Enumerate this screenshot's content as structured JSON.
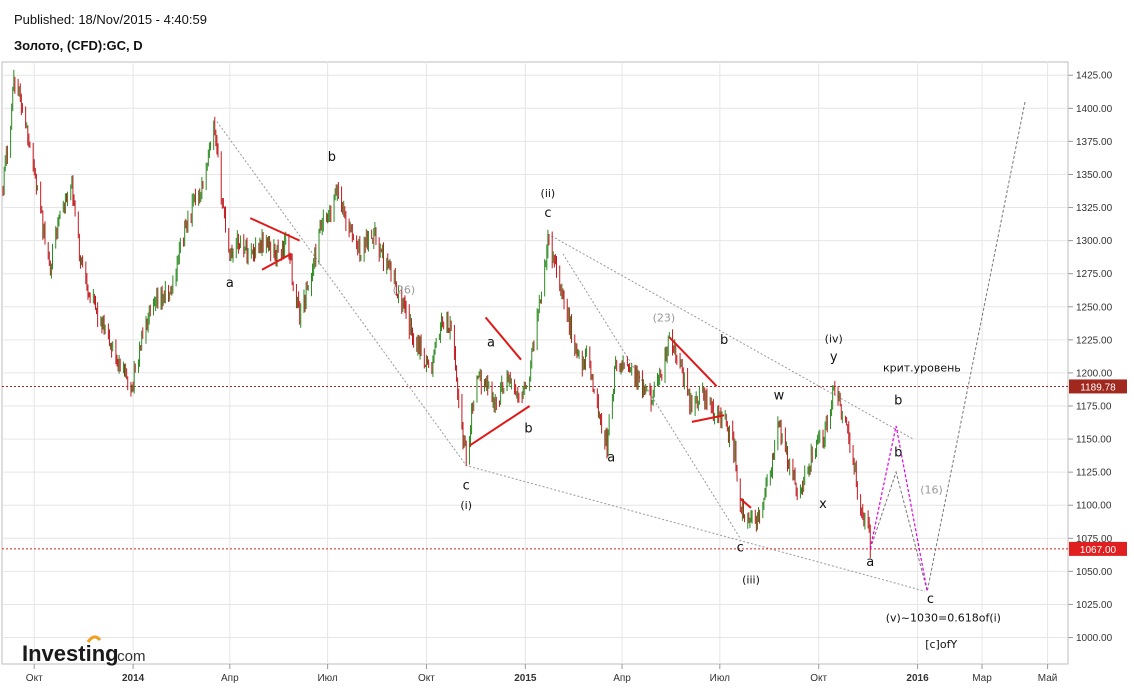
{
  "header": {
    "published": "Published: 18/Nov/2015 - 4:40:59",
    "title": "Золото, (CFD):GC, D"
  },
  "logo": {
    "brand": "Investing",
    "suffix": ".com"
  },
  "colors": {
    "up": "#2a8a1f",
    "down": "#c0181c",
    "wedge": "#e01818",
    "level": "#a0281e",
    "magenta": "#e000e0",
    "guide": "#999999"
  },
  "chart_data": {
    "type": "line",
    "title": "Золото, (CFD):GC, D",
    "xlabel": "",
    "ylabel": "",
    "ylim": [
      980,
      1435
    ],
    "xlim": [
      "2013-09-01",
      "2016-05-20"
    ],
    "grid": true,
    "y_ticks": [
      "1000.00",
      "1025.00",
      "1050.00",
      "1075.00",
      "1100.00",
      "1125.00",
      "1150.00",
      "1175.00",
      "1200.00",
      "1225.00",
      "1250.00",
      "1275.00",
      "1300.00",
      "1325.00",
      "1350.00",
      "1375.00",
      "1400.00",
      "1425.00"
    ],
    "x_ticks": [
      {
        "label": "Окт",
        "date": "2013-10-01"
      },
      {
        "label": "2014",
        "date": "2014-01-01"
      },
      {
        "label": "Апр",
        "date": "2014-04-01"
      },
      {
        "label": "Июл",
        "date": "2014-07-01"
      },
      {
        "label": "Окт",
        "date": "2014-10-01"
      },
      {
        "label": "2015",
        "date": "2015-01-01"
      },
      {
        "label": "Апр",
        "date": "2015-04-01"
      },
      {
        "label": "Июл",
        "date": "2015-07-01"
      },
      {
        "label": "Окт",
        "date": "2015-10-01"
      },
      {
        "label": "2016",
        "date": "2016-01-01"
      },
      {
        "label": "Мар",
        "date": "2016-03-01"
      },
      {
        "label": "Май",
        "date": "2016-05-01"
      }
    ],
    "price_path": [
      [
        "2013-09-01",
        1340
      ],
      [
        "2013-09-08",
        1380
      ],
      [
        "2013-09-12",
        1425
      ],
      [
        "2013-09-20",
        1400
      ],
      [
        "2013-09-28",
        1370
      ],
      [
        "2013-10-05",
        1330
      ],
      [
        "2013-10-15",
        1280
      ],
      [
        "2013-10-25",
        1320
      ],
      [
        "2013-11-05",
        1340
      ],
      [
        "2013-11-12",
        1290
      ],
      [
        "2013-11-22",
        1260
      ],
      [
        "2013-12-05",
        1230
      ],
      [
        "2013-12-15",
        1215
      ],
      [
        "2013-12-22",
        1200
      ],
      [
        "2013-12-31",
        1190
      ],
      [
        "2014-01-10",
        1230
      ],
      [
        "2014-01-25",
        1255
      ],
      [
        "2014-02-05",
        1260
      ],
      [
        "2014-02-15",
        1300
      ],
      [
        "2014-02-25",
        1325
      ],
      [
        "2014-03-10",
        1350
      ],
      [
        "2014-03-17",
        1385
      ],
      [
        "2014-03-25",
        1330
      ],
      [
        "2014-04-01",
        1290
      ],
      [
        "2014-04-10",
        1300
      ],
      [
        "2014-04-20",
        1290
      ],
      [
        "2014-05-01",
        1300
      ],
      [
        "2014-05-15",
        1290
      ],
      [
        "2014-05-25",
        1300
      ],
      [
        "2014-06-01",
        1255
      ],
      [
        "2014-06-05",
        1245
      ],
      [
        "2014-06-15",
        1270
      ],
      [
        "2014-06-25",
        1310
      ],
      [
        "2014-07-05",
        1320
      ],
      [
        "2014-07-10",
        1340
      ],
      [
        "2014-07-20",
        1310
      ],
      [
        "2014-08-01",
        1290
      ],
      [
        "2014-08-10",
        1310
      ],
      [
        "2014-08-20",
        1290
      ],
      [
        "2014-09-01",
        1270
      ],
      [
        "2014-09-15",
        1235
      ],
      [
        "2014-09-25",
        1220
      ],
      [
        "2014-10-05",
        1200
      ],
      [
        "2014-10-15",
        1240
      ],
      [
        "2014-10-25",
        1230
      ],
      [
        "2014-11-01",
        1170
      ],
      [
        "2014-11-07",
        1135
      ],
      [
        "2014-11-15",
        1190
      ],
      [
        "2014-11-25",
        1195
      ],
      [
        "2014-12-05",
        1175
      ],
      [
        "2014-12-15",
        1200
      ],
      [
        "2014-12-25",
        1180
      ],
      [
        "2015-01-05",
        1200
      ],
      [
        "2015-01-15",
        1260
      ],
      [
        "2015-01-22",
        1300
      ],
      [
        "2015-01-30",
        1280
      ],
      [
        "2015-02-10",
        1240
      ],
      [
        "2015-02-20",
        1210
      ],
      [
        "2015-03-01",
        1210
      ],
      [
        "2015-03-10",
        1170
      ],
      [
        "2015-03-18",
        1145
      ],
      [
        "2015-03-25",
        1200
      ],
      [
        "2015-04-05",
        1210
      ],
      [
        "2015-04-15",
        1195
      ],
      [
        "2015-04-25",
        1180
      ],
      [
        "2015-05-05",
        1190
      ],
      [
        "2015-05-15",
        1225
      ],
      [
        "2015-05-25",
        1205
      ],
      [
        "2015-06-05",
        1175
      ],
      [
        "2015-06-15",
        1185
      ],
      [
        "2015-06-25",
        1170
      ],
      [
        "2015-07-05",
        1165
      ],
      [
        "2015-07-15",
        1140
      ],
      [
        "2015-07-20",
        1100
      ],
      [
        "2015-07-25",
        1085
      ],
      [
        "2015-08-05",
        1090
      ],
      [
        "2015-08-15",
        1115
      ],
      [
        "2015-08-25",
        1160
      ],
      [
        "2015-09-05",
        1125
      ],
      [
        "2015-09-15",
        1110
      ],
      [
        "2015-09-25",
        1140
      ],
      [
        "2015-10-05",
        1150
      ],
      [
        "2015-10-15",
        1185
      ],
      [
        "2015-10-25",
        1165
      ],
      [
        "2015-11-01",
        1140
      ],
      [
        "2015-11-08",
        1100
      ],
      [
        "2015-11-15",
        1090
      ],
      [
        "2015-11-18",
        1067
      ]
    ],
    "levels": [
      {
        "label": "1189.78",
        "value": 1189.78,
        "color": "#a0281e"
      },
      {
        "label": "1067.00",
        "value": 1067.0,
        "color": "#e02020"
      }
    ],
    "projection_grey": [
      [
        "2015-11-18",
        1067
      ],
      [
        "2015-12-12",
        1125
      ],
      [
        "2016-01-10",
        1035
      ],
      [
        "2016-04-10",
        1405
      ]
    ],
    "projection_magenta": [
      [
        "2015-11-18",
        1067
      ],
      [
        "2015-12-12",
        1160
      ],
      [
        "2016-01-10",
        1035
      ]
    ],
    "guide_lines": [
      [
        [
          "2014-03-20",
          1390
        ],
        [
          "2014-11-07",
          1130
        ],
        [
          "2016-01-08",
          1035
        ]
      ],
      [
        [
          "2015-01-22",
          1305
        ],
        [
          "2015-12-28",
          1150
        ]
      ],
      [
        [
          "2015-02-05",
          1290
        ],
        [
          "2015-07-20",
          1075
        ]
      ]
    ],
    "wedges": [
      [
        [
          "2014-04-20",
          1317
        ],
        [
          "2014-06-05",
          1300
        ]
      ],
      [
        [
          "2014-05-01",
          1278
        ],
        [
          "2014-05-28",
          1290
        ]
      ],
      [
        [
          "2014-11-25",
          1242
        ],
        [
          "2014-12-28",
          1210
        ]
      ],
      [
        [
          "2014-11-10",
          1145
        ],
        [
          "2015-01-05",
          1175
        ]
      ],
      [
        [
          "2015-05-15",
          1227
        ],
        [
          "2015-06-28",
          1190
        ]
      ],
      [
        [
          "2015-06-05",
          1163
        ],
        [
          "2015-07-05",
          1168
        ]
      ],
      [
        [
          "2015-07-20",
          1105
        ],
        [
          "2015-07-30",
          1098
        ]
      ]
    ],
    "annotations": [
      {
        "text": "b",
        "x": "2014-07-05",
        "y": 1360,
        "style": "black"
      },
      {
        "text": "a",
        "x": "2014-04-01",
        "y": 1265,
        "style": "black"
      },
      {
        "text": "(26)",
        "x": "2014-09-10",
        "y": 1260,
        "style": "grey"
      },
      {
        "text": "(ii)",
        "x": "2015-01-22",
        "y": 1333,
        "style": "small"
      },
      {
        "text": "c",
        "x": "2015-01-22",
        "y": 1318,
        "style": "black"
      },
      {
        "text": "a",
        "x": "2014-11-30",
        "y": 1220,
        "style": "black"
      },
      {
        "text": "b",
        "x": "2015-01-04",
        "y": 1155,
        "style": "black"
      },
      {
        "text": "c",
        "x": "2014-11-07",
        "y": 1112,
        "style": "black"
      },
      {
        "text": "(i)",
        "x": "2014-11-07",
        "y": 1097,
        "style": "small"
      },
      {
        "text": "a",
        "x": "2015-03-22",
        "y": 1133,
        "style": "black"
      },
      {
        "text": "(23)",
        "x": "2015-05-10",
        "y": 1239,
        "style": "grey"
      },
      {
        "text": "b",
        "x": "2015-07-05",
        "y": 1222,
        "style": "black"
      },
      {
        "text": "w",
        "x": "2015-08-25",
        "y": 1180,
        "style": "black"
      },
      {
        "text": "x",
        "x": "2015-10-05",
        "y": 1098,
        "style": "black"
      },
      {
        "text": "c",
        "x": "2015-07-20",
        "y": 1065,
        "style": "black"
      },
      {
        "text": "(iii)",
        "x": "2015-07-30",
        "y": 1041,
        "style": "small"
      },
      {
        "text": "(iv)",
        "x": "2015-10-15",
        "y": 1223,
        "style": "small"
      },
      {
        "text": "y",
        "x": "2015-10-15",
        "y": 1209,
        "style": "black"
      },
      {
        "text": "крит.уровень",
        "x": "2016-01-05",
        "y": 1201,
        "style": "small"
      },
      {
        "text": "b",
        "x": "2015-12-14",
        "y": 1176,
        "style": "magenta"
      },
      {
        "text": "b",
        "x": "2015-12-14",
        "y": 1137,
        "style": "black"
      },
      {
        "text": "(16)",
        "x": "2016-01-14",
        "y": 1109,
        "style": "grey"
      },
      {
        "text": "a",
        "x": "2015-11-18",
        "y": 1054,
        "style": "black"
      },
      {
        "text": "c",
        "x": "2016-01-13",
        "y": 1026,
        "style": "black"
      },
      {
        "text": "(v)~1030=0.618of(i)",
        "x": "2016-01-25",
        "y": 1012,
        "style": "small"
      },
      {
        "text": "[c]ofY",
        "x": "2016-01-23",
        "y": 992,
        "style": "small"
      }
    ]
  }
}
